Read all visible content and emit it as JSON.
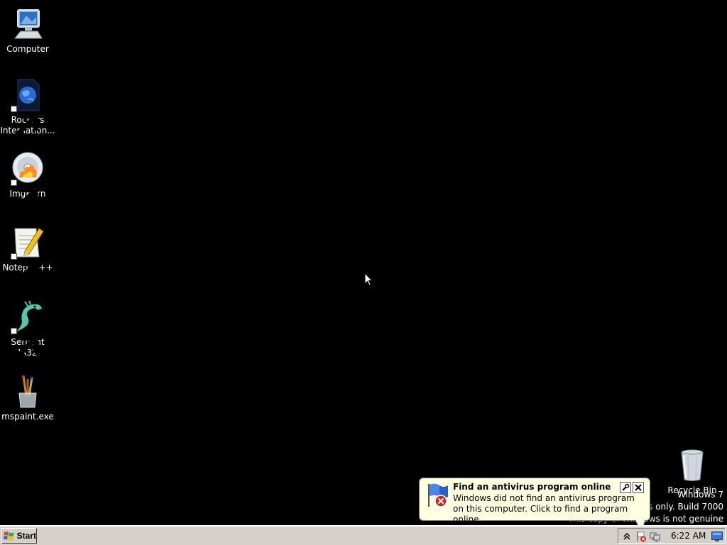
{
  "desktop": {
    "icons": [
      {
        "label": "Computer",
        "icon": "computer-icon"
      },
      {
        "label": "Rockers Internation...",
        "icon": "globe-document-icon"
      },
      {
        "label": "ImgBurn",
        "icon": "disc-flame-icon"
      },
      {
        "label": "Notepad++",
        "icon": "notepad-pencil-icon"
      },
      {
        "label": "Serpent IA32",
        "icon": "serpent-icon"
      },
      {
        "label": "mspaint.exe",
        "icon": "brushes-cup-icon"
      },
      {
        "label": "Recycle Bin",
        "icon": "recycle-bin-icon"
      }
    ],
    "background_color": "#000000"
  },
  "watermark": {
    "line1": "Windows 7",
    "line2": "For testing purposes only. Build 7000",
    "line3": "This copy of Windows is not genuine"
  },
  "notification": {
    "title": "Find an antivirus program online",
    "text": "Windows did not find an antivirus program on this computer. Click to find a program online.",
    "icon": "security-flag-icon",
    "options_icon": "wrench-icon",
    "close_icon": "close-icon",
    "background_color": "#ffffe1"
  },
  "taskbar": {
    "start_label": "Start",
    "clock": "6:22 AM",
    "tray_icons": [
      "chevron-up-icon",
      "action-center-error-icon",
      "network-icon",
      "show-desktop-icon"
    ],
    "background_color": "#d4d0c8"
  }
}
